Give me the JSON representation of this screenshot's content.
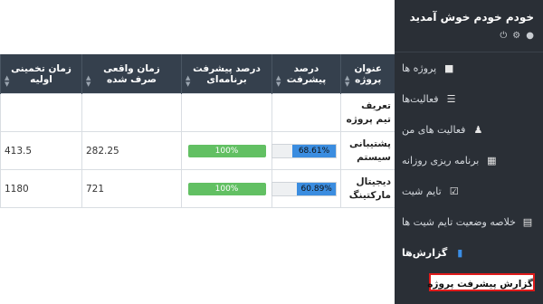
{
  "sidebar": {
    "welcome": "خودم خودم خوش آمدید",
    "header_icons": [
      "power-icon",
      "gear-icon",
      "user-icon"
    ],
    "items": [
      {
        "label": "پروژه ها",
        "icon": "cubes-icon"
      },
      {
        "label": "فعالیت‌ها",
        "icon": "list-icon"
      },
      {
        "label": "فعالیت های من",
        "icon": "user-tasks-icon"
      },
      {
        "label": "برنامه ریزی روزانه",
        "icon": "table-icon"
      },
      {
        "label": "تایم شیت",
        "icon": "calendar-check-icon"
      },
      {
        "label": "خلاصه وضعیت تایم شیت ها",
        "icon": "summary-icon"
      },
      {
        "label": "گزارش‌ها",
        "icon": "file-icon"
      }
    ],
    "submenu": {
      "active_label": "گزارش پیشرفت پروژه"
    }
  },
  "table": {
    "headers": {
      "project": "عنوان پروژه",
      "progress": "درصد پیشرفت",
      "planned_progress": "درصد پیشرفت برنامه‌ای",
      "actual_time": "زمان واقعی صرف شده",
      "estimated_time": "زمان تخمینی اولیه"
    },
    "rows": [
      {
        "project": "تعریف تیم پروژه",
        "progress": "",
        "progress_fraction": 0,
        "planned": "",
        "actual": "",
        "estimated": ""
      },
      {
        "project": "پشتیبانی سیستم",
        "progress": "68.61%",
        "progress_fraction": 0.6861,
        "planned": "100%",
        "actual": "282.25",
        "estimated": "413.5"
      },
      {
        "project": "دیجیتال مارکتینگ",
        "progress": "60.89%",
        "progress_fraction": 0.6089,
        "planned": "100%",
        "actual": "721",
        "estimated": "1180"
      }
    ]
  },
  "colors": {
    "sidebar_bg": "#2a2f36",
    "header_bg": "#35404d",
    "planned_bar": "#62c063",
    "progress_bar": "#3b8de0",
    "highlight_border": "#e01b1b"
  }
}
